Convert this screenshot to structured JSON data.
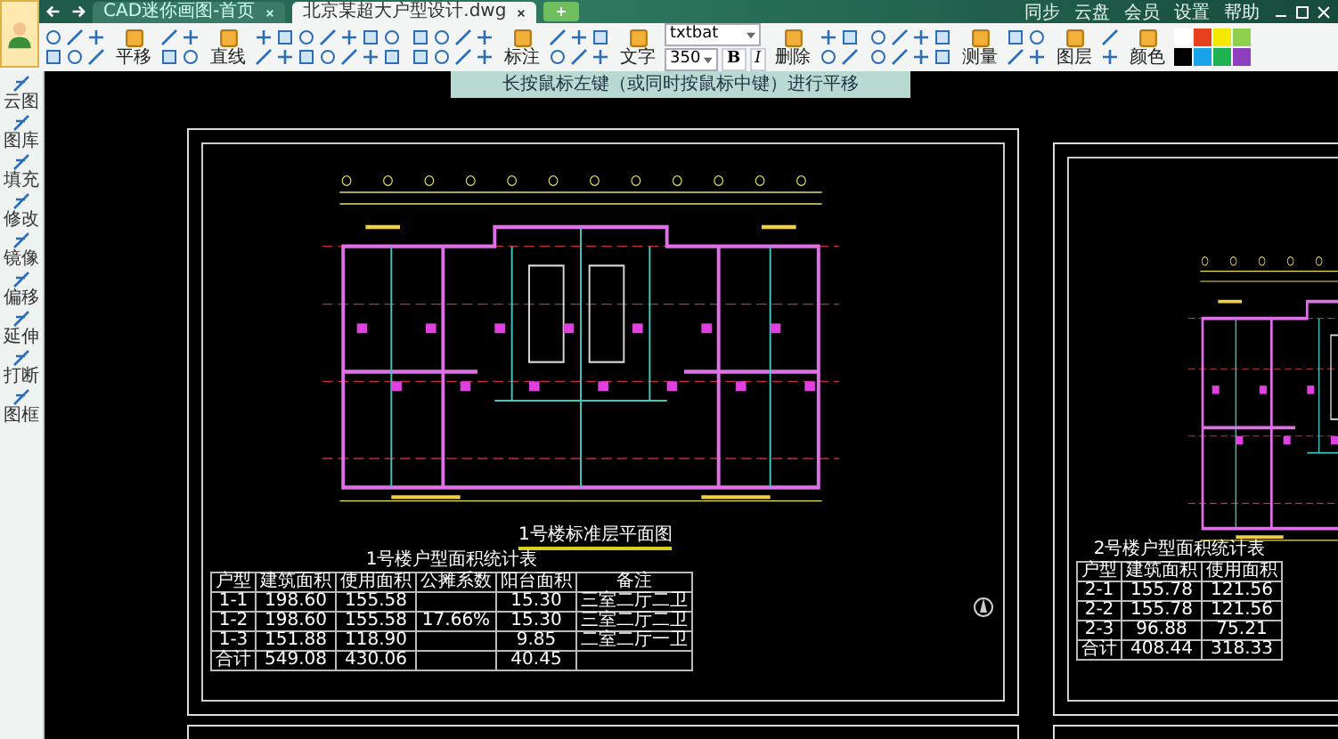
{
  "tabs": [
    {
      "label": "CAD迷你画图-首页",
      "selected": false
    },
    {
      "label": "北京某超大户型设计.dwg",
      "selected": true
    }
  ],
  "menu": [
    {
      "label": "同步"
    },
    {
      "label": "云盘"
    },
    {
      "label": "会员"
    },
    {
      "label": "设置"
    },
    {
      "label": "帮助"
    }
  ],
  "toolbar": {
    "tools": [
      {
        "label": "平移"
      },
      {
        "label": "直线"
      },
      {
        "label": "标注"
      },
      {
        "label": "文字"
      },
      {
        "label": "删除"
      },
      {
        "label": "测量"
      },
      {
        "label": "图层"
      },
      {
        "label": "颜色"
      }
    ],
    "font": {
      "value": "txtbat"
    },
    "size": {
      "value": "350"
    },
    "bold": "B",
    "italic": "I",
    "palette": [
      {
        "color": "#ffffff"
      },
      {
        "color": "#e8401c"
      },
      {
        "color": "#f5e800"
      },
      {
        "color": "#8fd14f"
      },
      {
        "color": "#000000"
      },
      {
        "color": "#1aa3e8"
      },
      {
        "color": "#1db350"
      },
      {
        "color": "#8e3fc0"
      }
    ]
  },
  "side_tools": [
    {
      "label": "云图"
    },
    {
      "label": "图库"
    },
    {
      "label": "填充"
    },
    {
      "label": "修改"
    },
    {
      "label": "镜像"
    },
    {
      "label": "偏移"
    },
    {
      "label": "延伸"
    },
    {
      "label": "打断"
    },
    {
      "label": "图框"
    }
  ],
  "hint": "长按鼠标左键（或同时按鼠标中键）进行平移",
  "sheets": [
    {
      "title": "1号楼标准层平面图",
      "table": {
        "title": "1号楼户型面积统计表",
        "columns": [
          "户型",
          "建筑面积",
          "使用面积",
          "公摊系数",
          "阳台面积",
          "备注"
        ],
        "rows": [
          [
            "1-1",
            "198.60",
            "155.58",
            "",
            "15.30",
            "三室二厅二卫"
          ],
          [
            "1-2",
            "198.60",
            "155.58",
            "17.66%",
            "15.30",
            "三室二厅二卫"
          ],
          [
            "1-3",
            "151.88",
            "118.90",
            "",
            "9.85",
            "二室二厅一卫"
          ],
          [
            "合计",
            "549.08",
            "430.06",
            "",
            "40.45",
            ""
          ]
        ]
      }
    },
    {
      "table": {
        "title": "2号楼户型面积统计表",
        "columns": [
          "户型",
          "建筑面积",
          "使用面积"
        ],
        "rows": [
          [
            "2-1",
            "155.78",
            "121.56"
          ],
          [
            "2-2",
            "155.78",
            "121.56"
          ],
          [
            "2-3",
            "96.88",
            "75.21"
          ],
          [
            "合计",
            "408.44",
            "318.33"
          ]
        ]
      }
    }
  ]
}
